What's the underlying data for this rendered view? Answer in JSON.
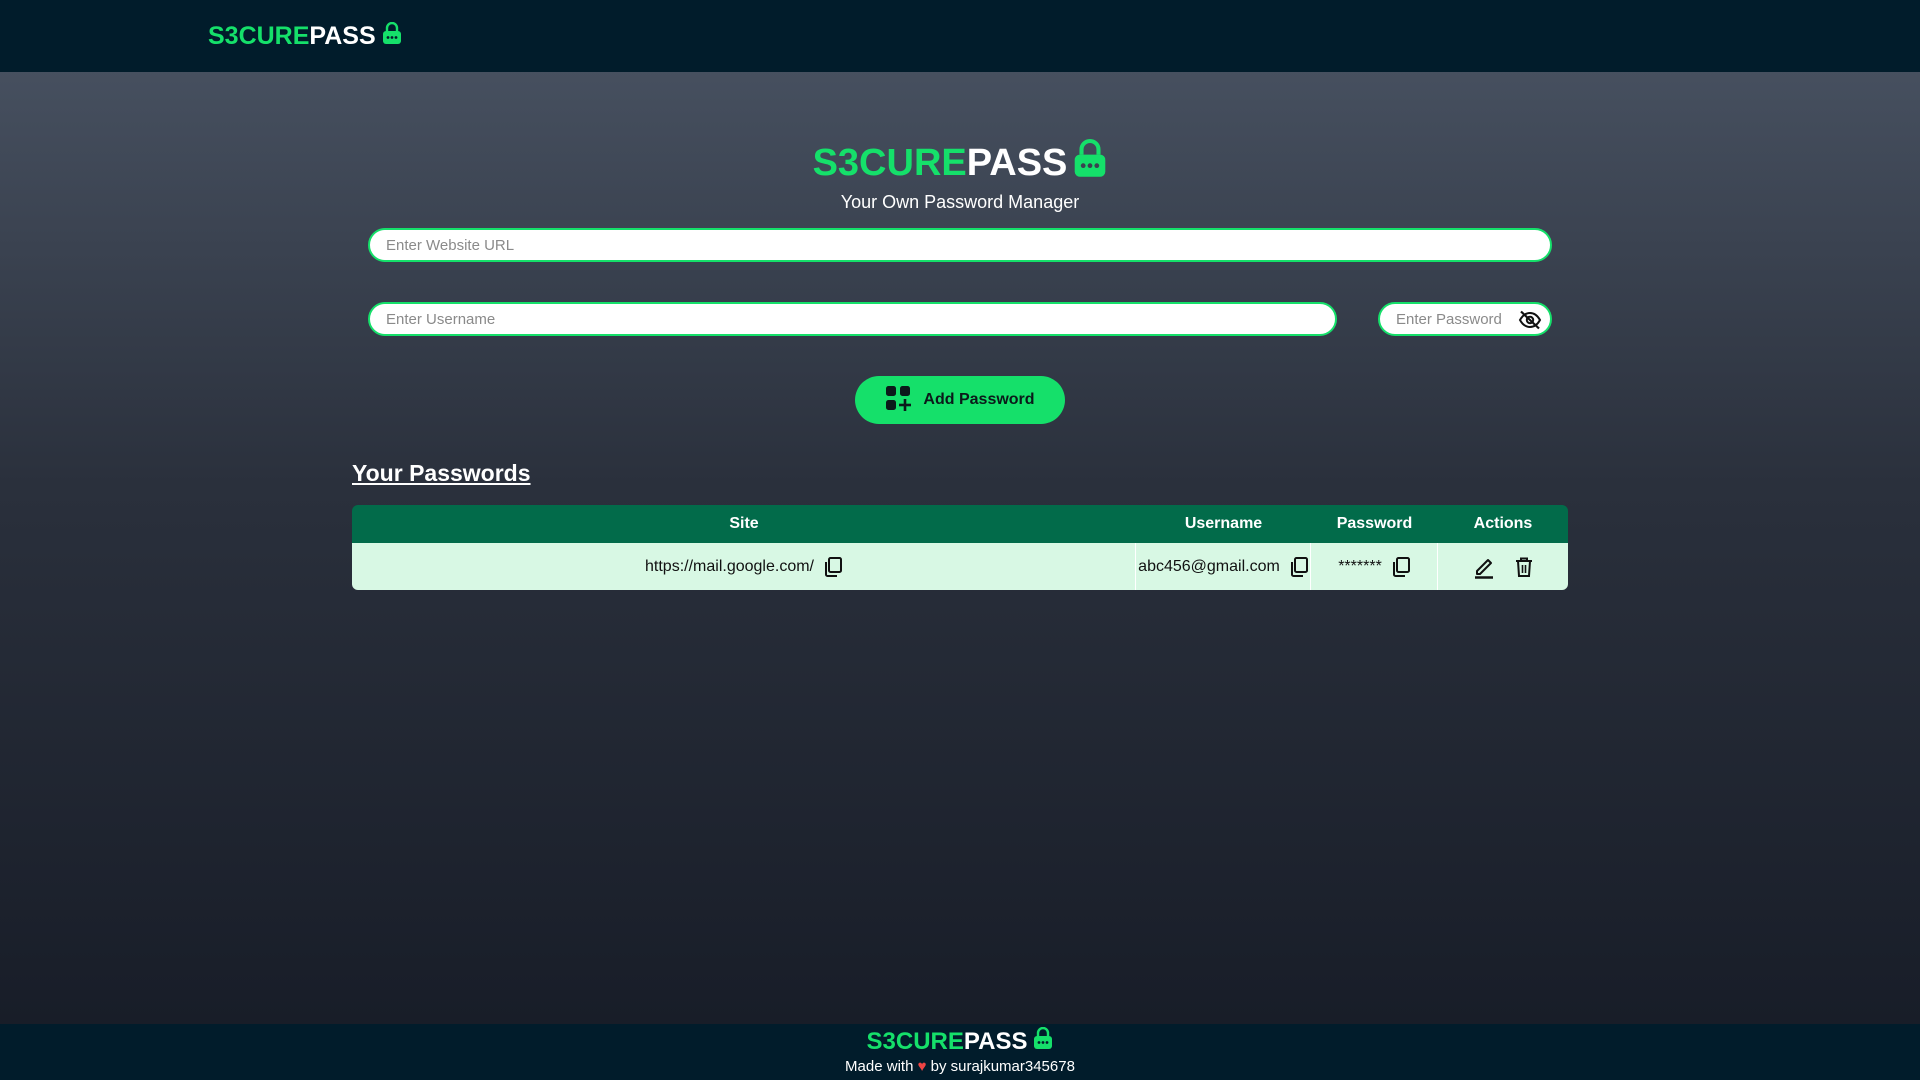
{
  "nav": {
    "brand_green": "S3CURE",
    "brand_white": "PASS"
  },
  "hero": {
    "brand_green": "S3CURE",
    "brand_white": "PASS",
    "subtitle": "Your Own Password Manager"
  },
  "form": {
    "url_placeholder": "Enter Website URL",
    "username_placeholder": "Enter Username",
    "password_placeholder": "Enter Password",
    "eye_icon": "eye-off-icon",
    "add_button_label": "Add Password",
    "add_icon": "grid-plus-icon"
  },
  "passwords": {
    "title": "Your Passwords",
    "columns": [
      "Site",
      "Username",
      "Password",
      "Actions"
    ],
    "rows": [
      {
        "site": "https://mail.google.com/",
        "username": "abc456@gmail.com",
        "password": "*******"
      }
    ]
  },
  "footer": {
    "brand_green": "S3CURE",
    "brand_white": "PASS",
    "made_prefix": "Made with",
    "made_suffix": "by surajkumar345678"
  },
  "colors": {
    "accent": "#15e06a",
    "header_bg": "#011c2b",
    "table_head": "#026b4a",
    "row_bg": "#d8f8e4"
  }
}
